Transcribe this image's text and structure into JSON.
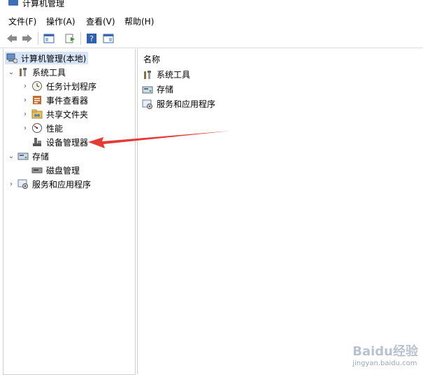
{
  "window": {
    "title": "计算机管理"
  },
  "menu": [
    "文件(F)",
    "操作(A)",
    "查看(V)",
    "帮助(H)"
  ],
  "tree": {
    "root": "计算机管理(本地)",
    "system_tools": "系统工具",
    "task_scheduler": "任务计划程序",
    "event_viewer": "事件查看器",
    "shared_folders": "共享文件夹",
    "performance": "性能",
    "device_manager": "设备管理器",
    "storage": "存储",
    "disk_management": "磁盘管理",
    "services_apps": "服务和应用程序"
  },
  "list": {
    "header": "名称",
    "items": [
      "系统工具",
      "存储",
      "服务和应用程序"
    ]
  },
  "watermark": {
    "brand": "Baidu经验",
    "url": "jingyan.baidu.com"
  },
  "colors": {
    "selection": "#d6e6f8",
    "annotation_arrow": "#e53b37"
  }
}
